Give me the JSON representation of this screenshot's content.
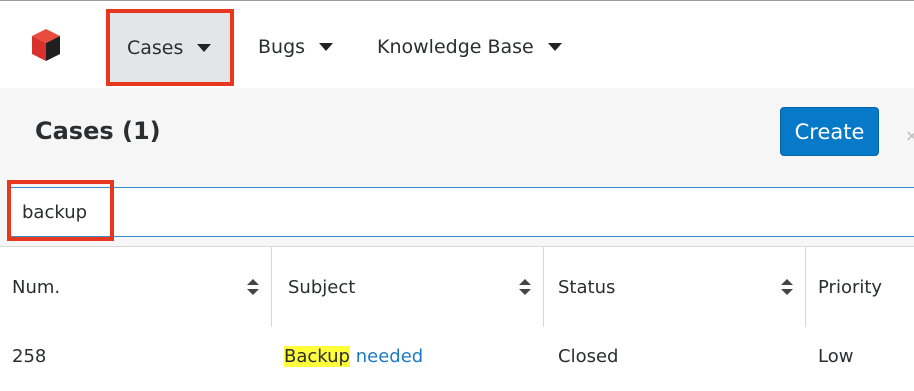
{
  "nav": {
    "items": [
      {
        "label": "Cases"
      },
      {
        "label": "Bugs"
      },
      {
        "label": "Knowledge Base"
      }
    ]
  },
  "header": {
    "title": "Cases (1)",
    "create_label": "Create",
    "close_glyph": "×"
  },
  "search": {
    "value": "backup"
  },
  "table": {
    "columns": [
      "Num.",
      "Subject",
      "Status",
      "Priority"
    ],
    "rows": [
      {
        "num": "258",
        "subject_highlight": "Backup",
        "subject_rest": " needed",
        "status": "Closed",
        "priority": "Low"
      }
    ]
  },
  "colors": {
    "accent": "#0679c8",
    "highlight_box": "#e8371f",
    "search_match": "#ffff3a"
  }
}
